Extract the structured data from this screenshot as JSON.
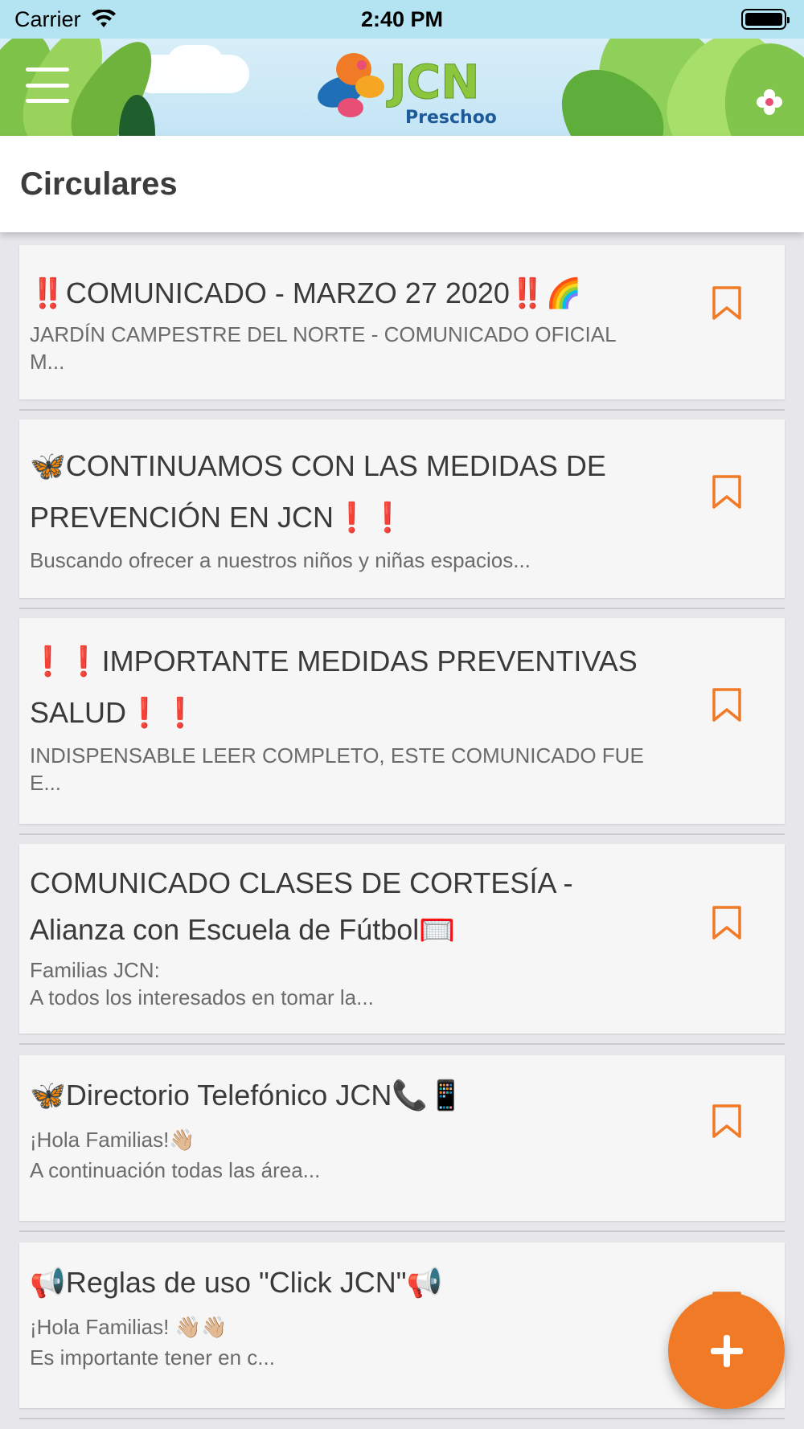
{
  "status_bar": {
    "carrier": "Carrier",
    "time": "2:40 PM"
  },
  "header": {
    "logo_text": "JCN",
    "logo_subtext": "Preschool",
    "menu_icon": "hamburger-menu-icon"
  },
  "page": {
    "title": "Circulares"
  },
  "circulars": [
    {
      "title": "‼️COMUNICADO - MARZO 27 2020‼️🌈",
      "body": "JARDÍN CAMPESTRE DEL NORTE - COMUNICADO OFICIAL\nM...",
      "icon": "bookmark-icon"
    },
    {
      "title": "🦋CONTINUAMOS CON LAS MEDIDAS DE PREVENCIÓN EN JCN❗️❗️",
      "body": "Buscando ofrecer a nuestros niños y niñas espacios...",
      "icon": "bookmark-icon"
    },
    {
      "title": "❗️❗️IMPORTANTE MEDIDAS PREVENTIVAS SALUD❗️❗️",
      "body": "INDISPENSABLE LEER COMPLETO, ESTE COMUNICADO FUE\nE...",
      "icon": "bookmark-icon"
    },
    {
      "title": "COMUNICADO CLASES DE CORTESÍA - Alianza con Escuela de Fútbol🥅",
      "body": "Familias JCN:\nA todos los interesados en tomar la...",
      "icon": "bookmark-icon"
    },
    {
      "title": "🦋Directorio Telefónico JCN📞📱",
      "body": "¡Hola Familias!👋🏼\nA continuación todas las área...",
      "icon": "bookmark-icon"
    },
    {
      "title": "📢Reglas de uso \"Click JCN\"📢",
      "body": "¡Hola Familias! 👋🏼👋🏼\nEs importante tener en c...",
      "icon": "bookmark-icon"
    }
  ],
  "fab": {
    "icon": "plus-icon"
  },
  "colors": {
    "accent": "#f07a25",
    "status_bar": "#b4e3f2",
    "card_bg": "#f6f6f7"
  }
}
